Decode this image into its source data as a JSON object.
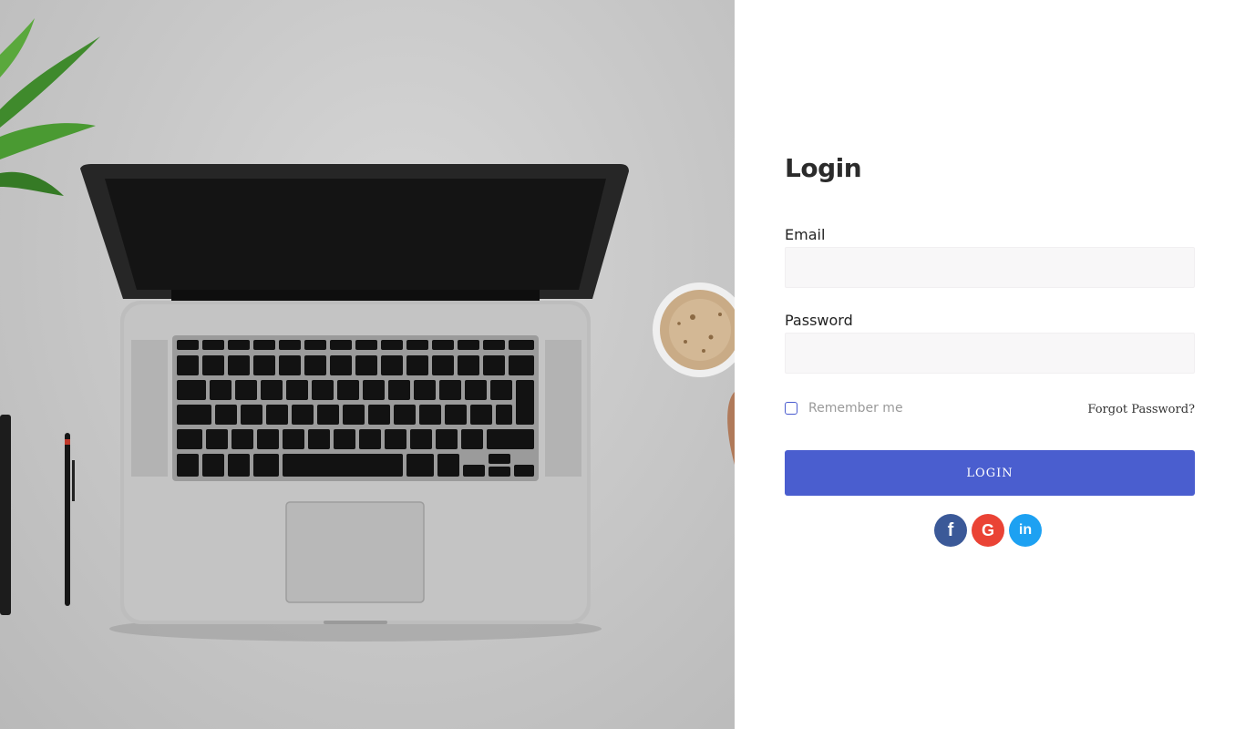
{
  "login": {
    "title": "Login",
    "email_label": "Email",
    "email_value": "",
    "password_label": "Password",
    "password_value": "",
    "remember_label": "Remember me",
    "remember_checked": false,
    "forgot_label": "Forgot Password?",
    "submit_label": "LOGIN"
  },
  "social": {
    "facebook": {
      "glyph": "f",
      "icon": "facebook-icon",
      "color": "#3b5998"
    },
    "google": {
      "glyph": "G",
      "icon": "google-icon",
      "color": "#ea4335"
    },
    "linkedin": {
      "glyph": "in",
      "icon": "linkedin-icon",
      "color": "#1da1f2"
    }
  },
  "colors": {
    "primary": "#4a5ecf",
    "input_bg": "#f8f7f8"
  }
}
